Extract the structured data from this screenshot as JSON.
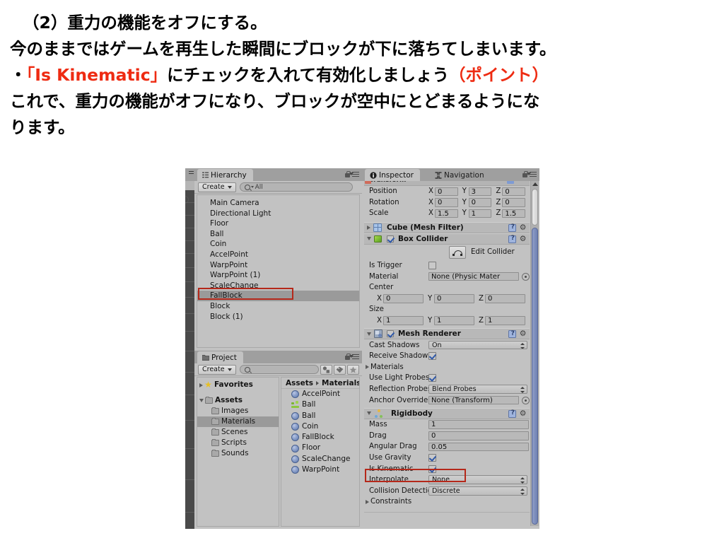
{
  "document": {
    "lines": [
      {
        "text": "（2）重力の機能をオフにする。",
        "indent": true,
        "segments": [
          {
            "t": "（2）重力の機能をオフにする。",
            "c": "black"
          }
        ]
      },
      {
        "text": "今のままではゲームを再生した瞬間にブロックが下に落ちてしまいます。",
        "indent": false,
        "segments": [
          {
            "t": "今のままではゲームを再生した瞬間にブロックが下に落ちてしまいます。",
            "c": "black"
          }
        ]
      },
      {
        "text": "・「Is Kinematic」にチェックを入れて有効化しましょう（ポイント）",
        "indent": false,
        "segments": [
          {
            "t": "・",
            "c": "black"
          },
          {
            "t": "「Is Kinematic」",
            "c": "red"
          },
          {
            "t": "にチェックを入れて有効化しましょう",
            "c": "black"
          },
          {
            "t": "（ポイント）",
            "c": "red"
          }
        ]
      },
      {
        "text": "これで、重力の機能がオフになり、ブロックが空中にとどまるようにな",
        "indent": false,
        "segments": [
          {
            "t": "これで、重力の機能がオフになり、ブロックが空中にとどまるようにな",
            "c": "black"
          }
        ]
      },
      {
        "text": "ります。",
        "indent": false,
        "segments": [
          {
            "t": "ります。",
            "c": "black"
          }
        ]
      }
    ],
    "accent_color": "#ee2b12"
  },
  "hierarchy": {
    "tab_label": "Hierarchy",
    "create_label": "Create",
    "search_placeholder": "All",
    "items": [
      {
        "label": "Main Camera",
        "selected": false
      },
      {
        "label": "Directional Light",
        "selected": false
      },
      {
        "label": "Floor",
        "selected": false
      },
      {
        "label": "Ball",
        "selected": false
      },
      {
        "label": "Coin",
        "selected": false
      },
      {
        "label": "AccelPoint",
        "selected": false
      },
      {
        "label": "WarpPoint",
        "selected": false
      },
      {
        "label": "WarpPoint (1)",
        "selected": false
      },
      {
        "label": "ScaleChange",
        "selected": false
      },
      {
        "label": "FallBlock",
        "selected": true
      },
      {
        "label": "Block",
        "selected": false
      },
      {
        "label": "Block (1)",
        "selected": false
      }
    ]
  },
  "project": {
    "tab_label": "Project",
    "create_label": "Create",
    "search_placeholder": "",
    "tree": [
      {
        "label": "Favorites",
        "depth": 0,
        "arrow": "right",
        "icon": "star-icon",
        "selected": false
      },
      {
        "label": "Assets",
        "depth": 0,
        "arrow": "down",
        "icon": "folder-icon",
        "selected": false
      },
      {
        "label": "Images",
        "depth": 1,
        "arrow": "none",
        "icon": "folder-icon",
        "selected": false
      },
      {
        "label": "Materials",
        "depth": 1,
        "arrow": "none",
        "icon": "folder-icon",
        "selected": true
      },
      {
        "label": "Scenes",
        "depth": 1,
        "arrow": "none",
        "icon": "folder-icon",
        "selected": false
      },
      {
        "label": "Scripts",
        "depth": 1,
        "arrow": "none",
        "icon": "folder-icon",
        "selected": false
      },
      {
        "label": "Sounds",
        "depth": 1,
        "arrow": "none",
        "icon": "folder-icon",
        "selected": false
      }
    ],
    "breadcrumb": {
      "root": "Assets",
      "current": "Materials"
    },
    "assets": [
      {
        "label": "AccelPoint",
        "icon": "material-icon"
      },
      {
        "label": "Ball",
        "icon": "prefab-icon"
      },
      {
        "label": "Ball",
        "icon": "material-icon"
      },
      {
        "label": "Coin",
        "icon": "material-icon"
      },
      {
        "label": "FallBlock",
        "icon": "material-icon"
      },
      {
        "label": "Floor",
        "icon": "material-icon"
      },
      {
        "label": "ScaleChange",
        "icon": "material-icon"
      },
      {
        "label": "WarpPoint",
        "icon": "material-icon"
      }
    ],
    "toolbar_icons": [
      "filter-by-type-icon",
      "filter-by-label-icon",
      "favorites-star-icon"
    ]
  },
  "inspector": {
    "tabs": [
      {
        "label": "Inspector",
        "active": true,
        "icon": "info-icon"
      },
      {
        "label": "Navigation",
        "active": false,
        "icon": "navigation-icon"
      }
    ],
    "transform": {
      "rows": [
        {
          "label": "Position",
          "x": "0",
          "y": "3",
          "z": "0"
        },
        {
          "label": "Rotation",
          "x": "0",
          "y": "0",
          "z": "0"
        },
        {
          "label": "Scale",
          "x": "1.5",
          "y": "1",
          "z": "1.5"
        }
      ]
    },
    "mesh_filter": {
      "title": "Cube (Mesh Filter)",
      "expanded": false
    },
    "box_collider": {
      "title": "Box Collider",
      "enabled": true,
      "expanded": true,
      "edit_collider_label": "Edit Collider",
      "is_trigger_label": "Is Trigger",
      "is_trigger_checked": false,
      "material_label": "Material",
      "material_value": "None (Physic Mater",
      "center_label": "Center",
      "center": {
        "x": "0",
        "y": "0",
        "z": "0"
      },
      "size_label": "Size",
      "size": {
        "x": "1",
        "y": "1",
        "z": "1"
      }
    },
    "mesh_renderer": {
      "title": "Mesh Renderer",
      "enabled": true,
      "expanded": true,
      "cast_shadows_label": "Cast Shadows",
      "cast_shadows_value": "On",
      "receive_shadows_label": "Receive Shadows",
      "receive_shadows_checked": true,
      "materials_label": "Materials",
      "use_light_probes_label": "Use Light Probes",
      "use_light_probes_checked": true,
      "reflection_probes_label": "Reflection Probes",
      "reflection_probes_value": "Blend Probes",
      "anchor_override_label": "Anchor Override",
      "anchor_override_value": "None (Transform)"
    },
    "rigidbody": {
      "title": "Rigidbody",
      "expanded": true,
      "mass_label": "Mass",
      "mass_value": "1",
      "drag_label": "Drag",
      "drag_value": "0",
      "angular_drag_label": "Angular Drag",
      "angular_drag_value": "0.05",
      "use_gravity_label": "Use Gravity",
      "use_gravity_checked": true,
      "is_kinematic_label": "Is Kinematic",
      "is_kinematic_checked": true,
      "interpolate_label": "Interpolate",
      "interpolate_value": "None",
      "collision_detection_label": "Collision Detection",
      "collision_detection_value": "Discrete",
      "constraints_label": "Constraints"
    }
  },
  "annotations": {
    "highlight_color": "#b5281a",
    "boxes": [
      {
        "target": "hierarchy-item-fallblock"
      },
      {
        "target": "rigidbody-is-kinematic-row"
      }
    ]
  }
}
